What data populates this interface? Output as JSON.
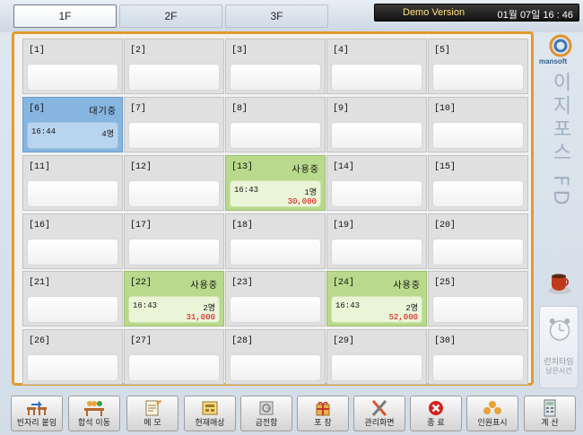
{
  "floors": [
    "1F",
    "2F",
    "3F"
  ],
  "header": {
    "demo_label": "Demo Version",
    "datetime": "01월 07일  16 : 46"
  },
  "tables": [
    {
      "num": "[1]"
    },
    {
      "num": "[2]"
    },
    {
      "num": "[3]"
    },
    {
      "num": "[4]"
    },
    {
      "num": "[5]"
    },
    {
      "num": "[6]",
      "status": "대기중",
      "time": "16:44",
      "people": "4명"
    },
    {
      "num": "[7]"
    },
    {
      "num": "[8]"
    },
    {
      "num": "[9]"
    },
    {
      "num": "[10]"
    },
    {
      "num": "[11]"
    },
    {
      "num": "[12]"
    },
    {
      "num": "[13]",
      "status": "사용중",
      "time": "16:43",
      "people": "1명",
      "amount": "30,000"
    },
    {
      "num": "[14]"
    },
    {
      "num": "[15]"
    },
    {
      "num": "[16]"
    },
    {
      "num": "[17]"
    },
    {
      "num": "[18]"
    },
    {
      "num": "[19]"
    },
    {
      "num": "[20]"
    },
    {
      "num": "[21]"
    },
    {
      "num": "[22]",
      "status": "사용중",
      "time": "16:43",
      "people": "2명",
      "amount": "31,000"
    },
    {
      "num": "[23]"
    },
    {
      "num": "[24]",
      "status": "사용중",
      "time": "16:43",
      "people": "2명",
      "amount": "52,000"
    },
    {
      "num": "[25]"
    },
    {
      "num": "[26]"
    },
    {
      "num": "[27]"
    },
    {
      "num": "[28]"
    },
    {
      "num": "[29]"
    },
    {
      "num": "[30]"
    }
  ],
  "side": {
    "brand": "mansoft",
    "title": "이지포스 FD",
    "lunch_label": "런치타임",
    "lunch_sub": "남은시간"
  },
  "toolbar": [
    {
      "label": "빈자리 붙임",
      "icon": "join-tables-icon"
    },
    {
      "label": "합석 이동",
      "icon": "move-seat-icon"
    },
    {
      "label": "메 모",
      "icon": "memo-icon"
    },
    {
      "label": "현재매상",
      "icon": "sales-icon"
    },
    {
      "label": "금전함",
      "icon": "cash-drawer-icon"
    },
    {
      "label": "포 장",
      "icon": "package-icon"
    },
    {
      "label": "관리화면",
      "icon": "admin-tools-icon"
    },
    {
      "label": "종 료",
      "icon": "exit-icon"
    },
    {
      "label": "인원표시",
      "icon": "people-display-icon"
    },
    {
      "label": "계 산",
      "icon": "calculator-icon"
    }
  ],
  "colors": {
    "accent_border": "#e39a2c",
    "waiting": "#86b5df",
    "in_use": "#b9d98c",
    "amount": "#d10000"
  }
}
